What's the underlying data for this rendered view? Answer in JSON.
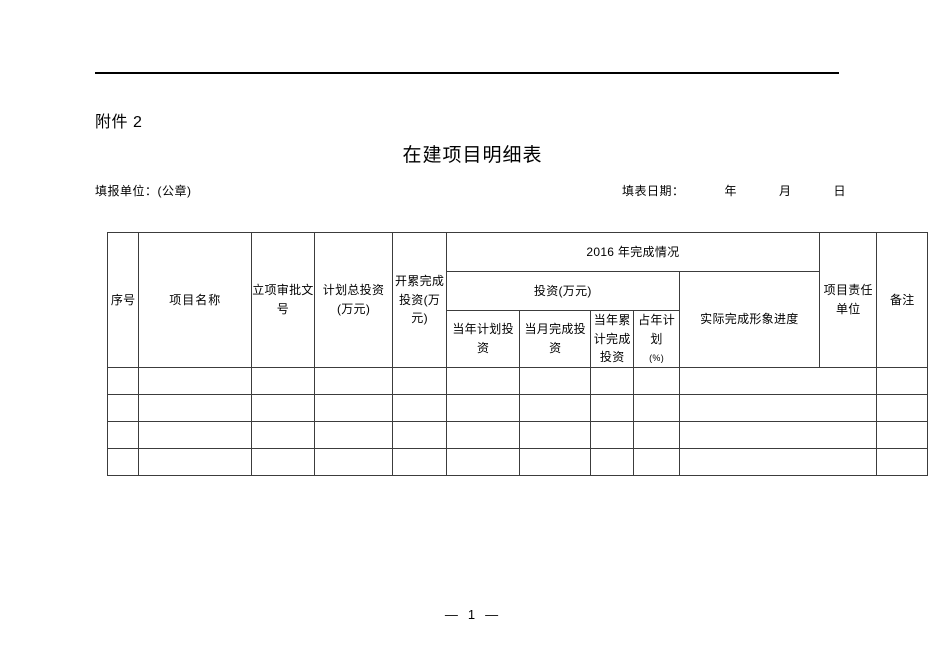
{
  "document": {
    "attachment_label": "附件 2",
    "title": "在建项目明细表",
    "reporting_unit_label": "填报单位：(公章)",
    "fill_date_label": "填表日期：",
    "year_unit": "年",
    "month_unit": "月",
    "day_unit": "日",
    "page_number": "1",
    "dash_left": "—",
    "dash_right": "—"
  },
  "table": {
    "headers": {
      "seq_no": "序号",
      "project_name": "项目名称",
      "approval_doc_no": "立项审批文号",
      "planned_total_investment": "计划总投资(万元)",
      "cumulative_completed_investment": "开累完成投资(万元)",
      "year_completion_group": "2016 年完成情况",
      "investment_group": "投资(万元)",
      "current_year_planned_investment": "当年计划投资",
      "current_month_completed_investment": "当月完成投资",
      "current_year_cumulative_completed_investment": "当年累计完成投资",
      "percent_of_year_plan": "占年计划",
      "percent_symbol": "(%)",
      "actual_physical_progress": "实际完成形象进度",
      "responsible_unit": "项目责任单位",
      "remarks": "备注"
    },
    "data_rows": [
      [
        "",
        "",
        "",
        "",
        "",
        "",
        "",
        "",
        "",
        "",
        ""
      ],
      [
        "",
        "",
        "",
        "",
        "",
        "",
        "",
        "",
        "",
        "",
        ""
      ],
      [
        "",
        "",
        "",
        "",
        "",
        "",
        "",
        "",
        "",
        "",
        ""
      ],
      [
        "",
        "",
        "",
        "",
        "",
        "",
        "",
        "",
        "",
        "",
        ""
      ]
    ]
  }
}
